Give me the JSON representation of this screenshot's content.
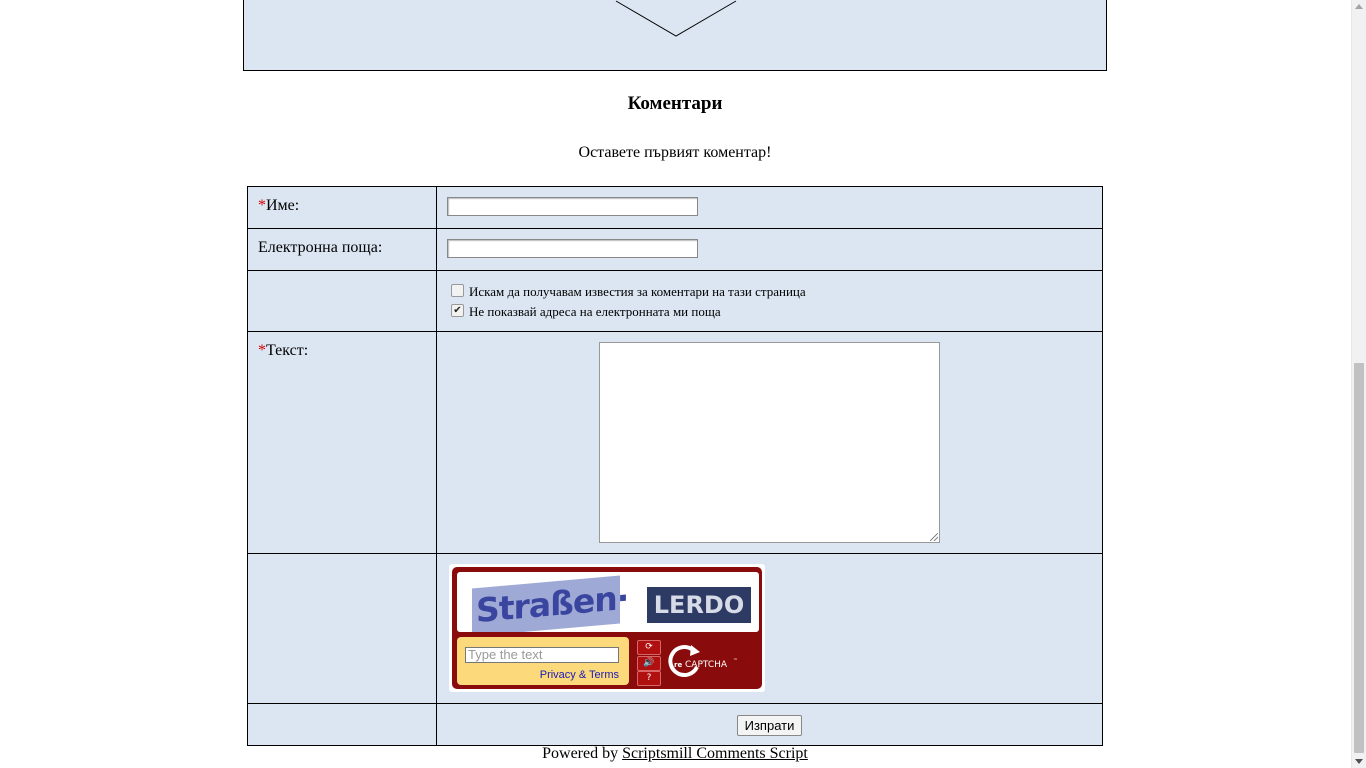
{
  "comments": {
    "title": "Коментари",
    "first_comment_prompt": "Оставете първият коментар!"
  },
  "form": {
    "required_marker": "*",
    "name_label": "Име:",
    "name_value": "",
    "email_label": "Електронна поща:",
    "email_value": "",
    "notify_label": "Искам да получавам известия за коментари на тази страница",
    "notify_checked": false,
    "hide_email_label": "Не показвай адреса на електронната ми поща",
    "hide_email_checked": true,
    "text_label": "Текст:",
    "text_value": "",
    "submit_label": "Изпрати"
  },
  "captcha": {
    "word1": "Straßen·",
    "word2": "LERDO",
    "input_placeholder": "Type the text",
    "privacy_link": "Privacy & Terms",
    "brand": "reCAPTCHA™",
    "buttons": [
      "refresh-icon",
      "audio-icon",
      "help-icon"
    ]
  },
  "footer": {
    "powered_by": "Powered by",
    "script_link": "Scriptsmill Comments Script"
  },
  "colors": {
    "panel_bg": "#dce6f2",
    "required": "#d40000",
    "captcha_red": "#8a0b0b",
    "captcha_yellow": "#fcd97b"
  }
}
